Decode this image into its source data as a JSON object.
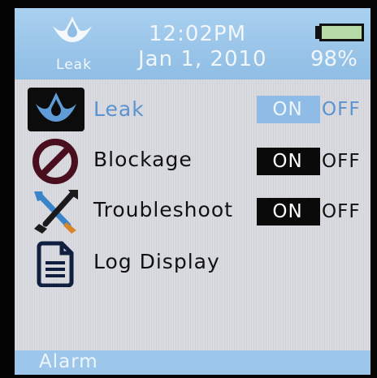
{
  "header": {
    "icon_label": "Leak",
    "time": "12:02PM",
    "date": "Jan 1, 2010",
    "battery_percent": "98%"
  },
  "menu": [
    {
      "label": "Leak",
      "icon": "water-drop-icon",
      "toggle": {
        "on": "ON",
        "off": "OFF"
      },
      "selected": true
    },
    {
      "label": "Blockage",
      "icon": "no-entry-icon",
      "toggle": {
        "on": "ON",
        "off": "OFF"
      },
      "selected": false
    },
    {
      "label": "Troubleshoot",
      "icon": "wrench-screwdriver-icon",
      "toggle": {
        "on": "ON",
        "off": "OFF"
      },
      "selected": false
    },
    {
      "label": "Log Display",
      "icon": "document-icon",
      "selected": false
    }
  ],
  "footer": {
    "label": "Alarm"
  },
  "colors": {
    "accent": "#9cc7ea",
    "selected_text": "#5a93cf",
    "background": "#d9dbe0"
  }
}
